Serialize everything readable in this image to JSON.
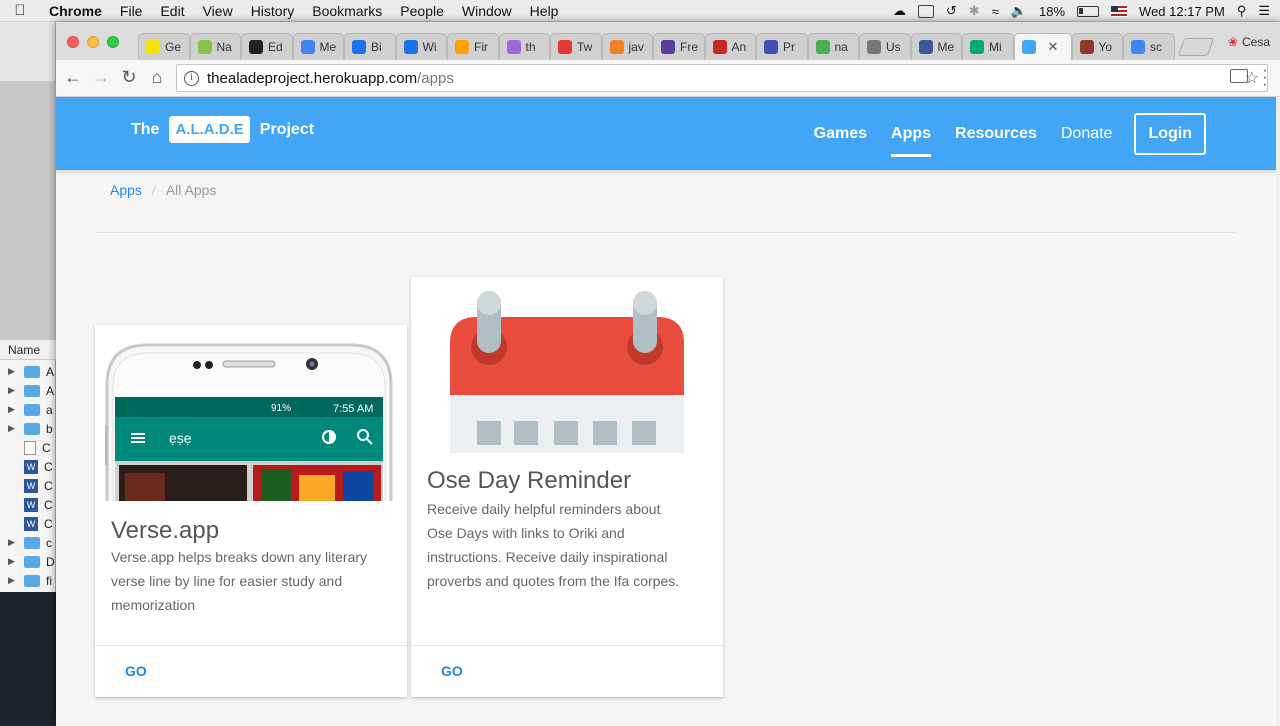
{
  "menubar": {
    "app": "Chrome",
    "items": [
      "File",
      "Edit",
      "View",
      "History",
      "Bookmarks",
      "People",
      "Window",
      "Help"
    ],
    "battery": "18%",
    "clock": "Wed 12:17 PM"
  },
  "finder": {
    "column_header": "Name",
    "rows": [
      "A",
      "A",
      "a",
      "b",
      "C",
      "C",
      "C",
      "C",
      "C",
      "c",
      "D",
      "fi"
    ]
  },
  "tabs": [
    {
      "label": "Ge",
      "color": "#f5e300"
    },
    {
      "label": "Na",
      "color": "#8bc34a"
    },
    {
      "label": "Ed",
      "color": "#222222"
    },
    {
      "label": "Me",
      "color": "#4285f4"
    },
    {
      "label": "Bi",
      "color": "#1a73e8"
    },
    {
      "label": "Wi",
      "color": "#1a73e8"
    },
    {
      "label": "Fir",
      "color": "#ffa000"
    },
    {
      "label": "th",
      "color": "#9c6ad6"
    },
    {
      "label": "Tw",
      "color": "#e53935"
    },
    {
      "label": "jav",
      "color": "#f48024"
    },
    {
      "label": "Fre",
      "color": "#5c3d99"
    },
    {
      "label": "An",
      "color": "#c62828"
    },
    {
      "label": "Pr",
      "color": "#3f51b5"
    },
    {
      "label": "na",
      "color": "#4caf50"
    },
    {
      "label": "Us",
      "color": "#777777"
    },
    {
      "label": "Me",
      "color": "#3b5998"
    },
    {
      "label": "Mi",
      "color": "#00ab6c"
    },
    {
      "label": "",
      "color": "#42a5f5",
      "active": true
    },
    {
      "label": "Yo",
      "color": "#8d3a2b"
    },
    {
      "label": "sc",
      "color": "#4285f4"
    }
  ],
  "profile": "Cesa",
  "address": {
    "host": "thealadeproject.herokuapp.com",
    "path": "/apps"
  },
  "site": {
    "brand_prefix": "The",
    "brand_pill": "A.L.A.D.E",
    "brand_suffix": "Project",
    "nav": [
      "Games",
      "Apps",
      "Resources",
      "Donate"
    ],
    "login": "Login",
    "accent": "#42a5f5"
  },
  "breadcrumb": {
    "root": "Apps",
    "separator": "/",
    "current": "All Apps"
  },
  "apps": [
    {
      "title": "Verse.app",
      "description": "Verse.app helps breaks down any literary verse line by line for easier study and memorization",
      "action": "GO",
      "phone_status": "91%",
      "phone_time": "7:55 AM",
      "phone_app_title": "ẹṣẹ"
    },
    {
      "title": "Ose Day Reminder",
      "description": "Receive daily helpful reminders about Ose Days with links to Oriki and instructions. Receive daily inspirational proverbs and quotes from the Ifa corpes.",
      "action": "GO"
    }
  ]
}
